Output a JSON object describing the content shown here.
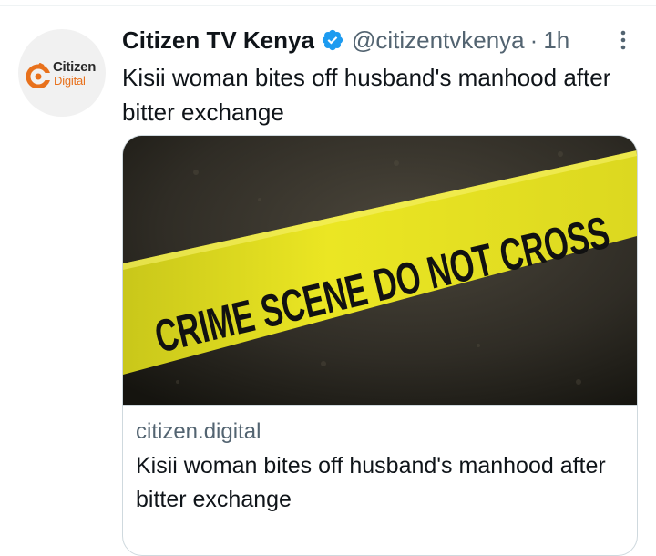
{
  "tweet": {
    "display_name": "Citizen TV Kenya",
    "handle": "@citizentvkenya",
    "separator": "·",
    "time": "1h",
    "text": "Kisii woman bites off husband's manhood after bitter exchange",
    "avatar": {
      "line1": "Citizen",
      "line2": "Digital"
    }
  },
  "card": {
    "image_text": "CRIME SCENE DO NOT CROSS",
    "domain": "citizen.digital",
    "title": "Kisii woman bites off husband's manhood after bitter exchange"
  },
  "colors": {
    "verified": "#1d9bf0",
    "secondary_text": "#536471",
    "tape_yellow": "#e5e21f",
    "brand_orange": "#e8711c"
  },
  "icons": {
    "verified": "verified-badge-icon",
    "more": "more-dots-icon"
  }
}
